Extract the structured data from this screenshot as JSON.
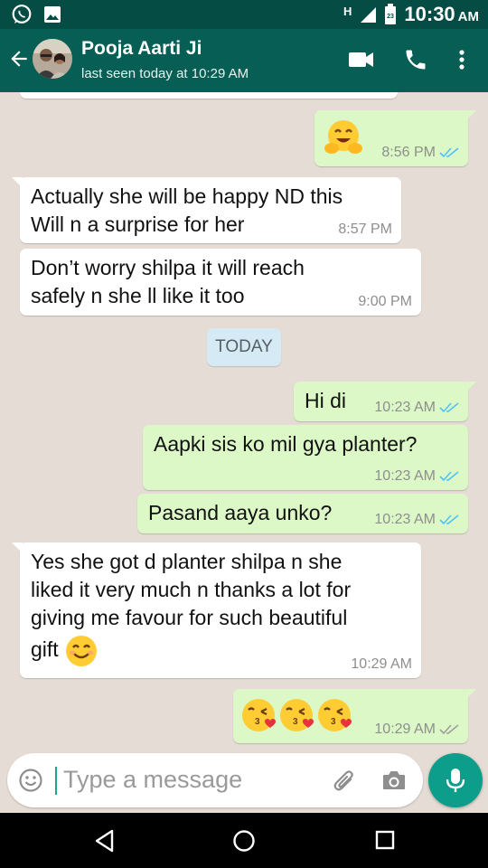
{
  "status_bar": {
    "time": "10:30",
    "ampm": "AM",
    "network": "H",
    "battery_level": "23"
  },
  "header": {
    "contact_name": "Pooja Aarti Ji",
    "last_seen": "last seen today at 10:29 AM"
  },
  "messages": [
    {
      "id": "m1",
      "dir": "out",
      "text": "",
      "time": "8:56 PM",
      "emoji": [
        "hugging-face"
      ],
      "ticks": "blue"
    },
    {
      "id": "m2",
      "dir": "in",
      "lines": [
        "Actually she will be happy ND this",
        "Will n a surprise for her"
      ],
      "time": "8:57 PM"
    },
    {
      "id": "m3",
      "dir": "in",
      "lines": [
        "Don’t worry shilpa it will reach",
        "safely n she ll like it too"
      ],
      "time": "9:00 PM"
    },
    {
      "id": "m4",
      "dir": "out",
      "text": "Hi di",
      "time": "10:23 AM",
      "ticks": "blue"
    },
    {
      "id": "m5",
      "dir": "out",
      "text": "Aapki sis ko mil gya planter?",
      "time": "10:23 AM",
      "ticks": "blue"
    },
    {
      "id": "m6",
      "dir": "out",
      "text": "Pasand aaya unko?",
      "time": "10:23 AM",
      "ticks": "blue"
    },
    {
      "id": "m7",
      "dir": "in",
      "lines": [
        "Yes she got d planter shilpa n she",
        "liked it very much n thanks a lot for",
        "giving me favour for such beautiful",
        "gift"
      ],
      "emoji": [
        "smiling-face"
      ],
      "time": "10:29 AM"
    },
    {
      "id": "m8",
      "dir": "out",
      "text": "",
      "emoji": [
        "kissing-face",
        "kissing-face",
        "kissing-face"
      ],
      "time": "10:29 AM",
      "ticks": "grey"
    }
  ],
  "day_label": "TODAY",
  "composer": {
    "placeholder": "Type a message"
  },
  "colors": {
    "header": "#075e54",
    "status_bar": "#054d44",
    "outgoing": "#dcf8c6",
    "incoming": "#ffffff",
    "wallpaper": "#e5ddd5",
    "read_tick": "#4fc3f7",
    "mic_button": "#0c9e8a"
  },
  "icons": [
    "whatsapp-icon",
    "gallery-icon",
    "signal-icon",
    "battery-icon",
    "back-arrow-icon",
    "video-call-icon",
    "voice-call-icon",
    "more-options-icon",
    "emoji-icon",
    "attach-icon",
    "camera-icon",
    "mic-icon",
    "nav-back-icon",
    "nav-home-icon",
    "nav-recents-icon"
  ]
}
